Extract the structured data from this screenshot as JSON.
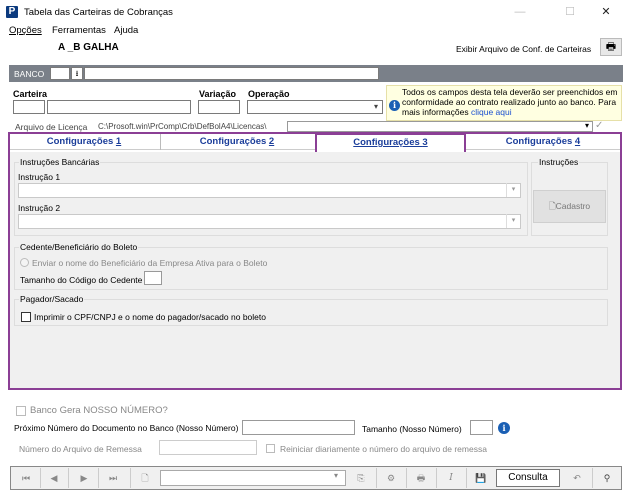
{
  "window": {
    "title": "Tabela das Carteiras de Cobranças",
    "app_icon_letter": "P",
    "minimize": "—",
    "maximize": "☐",
    "close": "✕"
  },
  "menu": [
    "Opções",
    "Ferramentas",
    "Ajuda"
  ],
  "header": {
    "company": "A _B GALHA",
    "show_link": "Exibir Arquivo de Conf. de Carteiras"
  },
  "banco": {
    "label": "BANCO",
    "code": "",
    "name": ""
  },
  "fields": {
    "carteira_label": "Carteira",
    "variacao_label": "Variação",
    "operacao_label": "Operação",
    "info_text": "Todos os campos desta tela deverão ser preenchidos em conformidade ao contrato realizado junto ao banco. Para mais informações",
    "info_link": "clique aqui",
    "licenca_label": "Arquivo de Licença",
    "licenca_path": "C:\\Prosoft.win\\PrComp\\Crb\\DefBolA4\\Licencas\\"
  },
  "tabs": [
    {
      "prefix": "Configurações ",
      "num": "1"
    },
    {
      "prefix": "Configurações ",
      "num": "2"
    },
    {
      "prefix": "Configurações ",
      "num": "3"
    },
    {
      "prefix": "Configurações ",
      "num": "4"
    }
  ],
  "active_tab": 2,
  "tab3": {
    "instrucoes_bancarias": "Instruções Bancárias",
    "instrucao1": "Instrução 1",
    "instrucao2": "Instrução 2",
    "instrucoes": "Instruções",
    "cadastro": "Cadastro",
    "cedente_group": "Cedente/Beneficiário do Boleto",
    "enviar_nome": "Enviar o nome do  Beneficiário da Empresa Ativa para o Boleto",
    "tamanho_cedente": "Tamanho do Código do Cedente",
    "pagador_group": "Pagador/Sacado",
    "imprimir_cpf": "Imprimir o CPF/CNPJ e o nome do pagador/sacado no boleto"
  },
  "bottom": {
    "banco_gera": "Banco Gera NOSSO NÚMERO?",
    "proximo_numero": "Próximo Número do Documento no Banco (Nosso Número)",
    "tamanho": "Tamanho (Nosso Número)",
    "numero_arquivo": "Número do Arquivo de Remessa",
    "reiniciar": "Reiniciar diariamente o número do arquivo de remessa"
  },
  "navbar": {
    "consulta": "Consulta"
  },
  "colors": {
    "accent": "#8b3f95",
    "tab_text": "#1a3d9a",
    "banco_bar": "#7a8089",
    "info_bg": "#ffffe1"
  }
}
